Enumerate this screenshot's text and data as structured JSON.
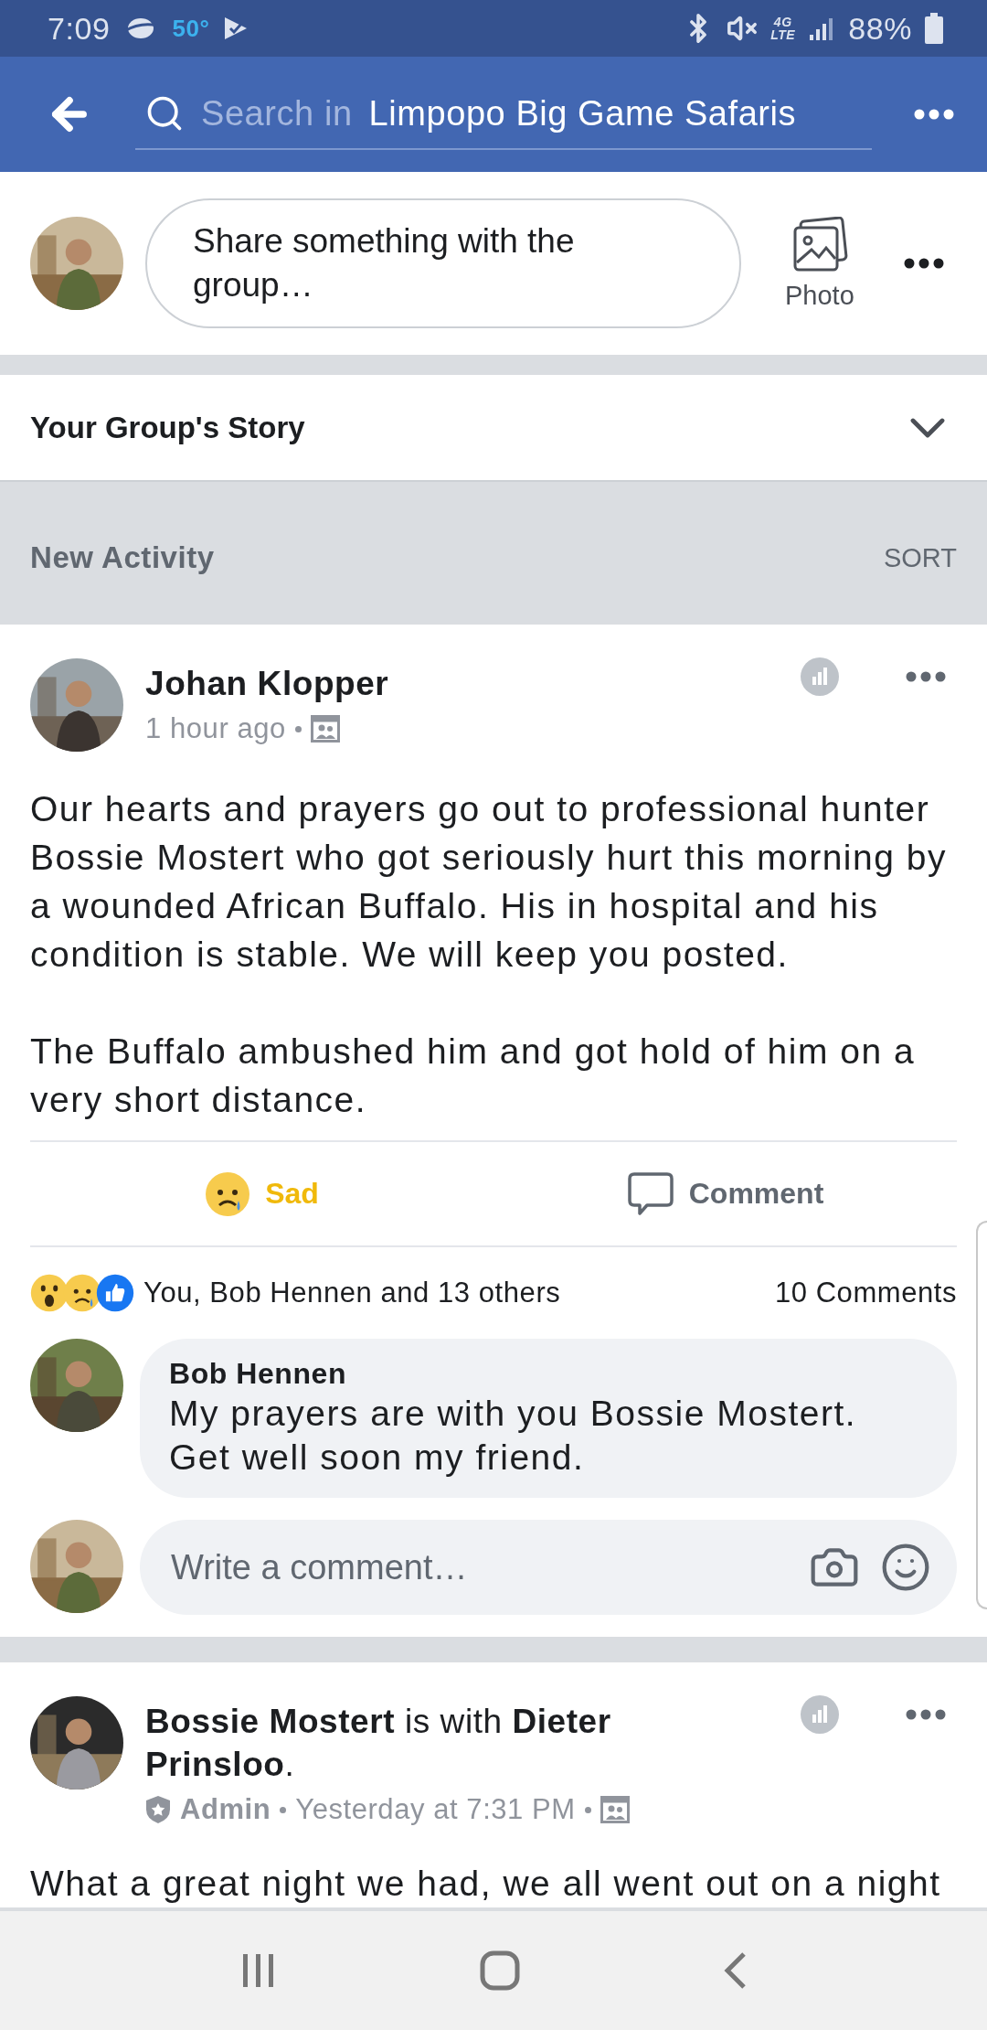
{
  "status_bar": {
    "time": "7:09",
    "temperature": "50°",
    "network": {
      "top": "4G",
      "bottom": "LTE"
    },
    "battery": "88%"
  },
  "header": {
    "search_prefix": "Search in",
    "group_name": "Limpopo Big Game Safaris"
  },
  "composer": {
    "avatar": {
      "kind": "picture"
    },
    "placeholder": "Share something with the group…",
    "photo_label": "Photo"
  },
  "story": {
    "label": "Your Group's Story",
    "expanded": false
  },
  "activity": {
    "title": "New Activity",
    "sort": "SORT"
  },
  "posts": [
    {
      "avatar": {
        "kind": "picture"
      },
      "author": "Johan Klopper",
      "time": "1 hour ago",
      "body": [
        "Our hearts and prayers go out to professional hunter Bossie Mostert who got seriously hurt this morning by a wounded African Buffalo. His in hospital and his condition is stable. We will keep you posted.",
        "The Buffalo ambushed him and got hold of him on a very short distance."
      ],
      "reaction_button": {
        "kind": "sad",
        "label": "Sad"
      },
      "comment_button": "Comment",
      "reaction_icons": [
        {
          "kind": "wow"
        },
        {
          "kind": "sad"
        },
        {
          "kind": "like"
        }
      ],
      "reaction_summary": "You, Bob Hennen and 13 others",
      "comment_count": "10 Comments",
      "comments": [
        {
          "avatar": {
            "kind": "picture"
          },
          "author": "Bob Hennen",
          "text": "My prayers are with you Bossie Mostert. Get well soon my friend."
        }
      ],
      "write_comment": {
        "avatar": {
          "kind": "picture"
        },
        "placeholder": "Write a comment…"
      }
    },
    {
      "avatar": {
        "kind": "picture"
      },
      "author": "Bossie Mostert",
      "tagged": {
        "text": "is with",
        "name": "Dieter Prinsloo",
        "end": "."
      },
      "role": "Admin",
      "time": "Yesterday at 7:31 PM",
      "body": [
        "What a great night we had, we all went out on a night"
      ]
    }
  ]
}
